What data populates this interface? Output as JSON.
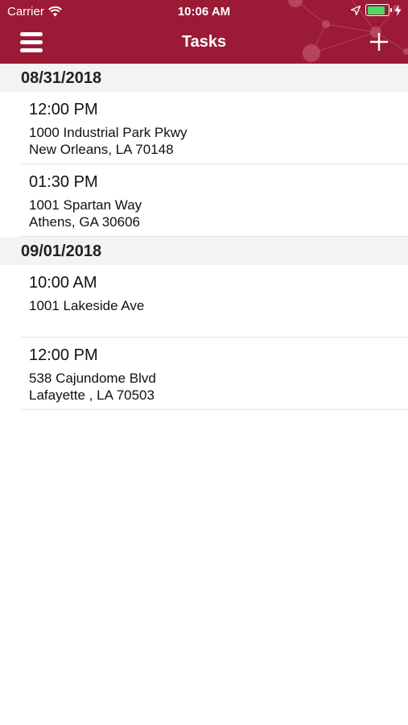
{
  "status_bar": {
    "carrier": "Carrier",
    "time": "10:06 AM",
    "battery_level": 0.85,
    "icons": [
      "wifi-icon",
      "location-arrow-icon",
      "battery-icon",
      "charging-bolt-icon"
    ]
  },
  "header": {
    "title": "Tasks",
    "menu_icon": "hamburger-menu-icon",
    "add_icon": "plus-icon"
  },
  "colors": {
    "header_bg": "#9b1b36",
    "section_bg": "#f3f3f3",
    "battery_fill": "#4cd964"
  },
  "sections": [
    {
      "date": "08/31/2018",
      "tasks": [
        {
          "time": "12:00 PM",
          "line1": "1000 Industrial Park Pkwy",
          "line2": "New Orleans, LA 70148"
        },
        {
          "time": "01:30 PM",
          "line1": "1001 Spartan Way",
          "line2": "Athens, GA 30606"
        }
      ]
    },
    {
      "date": "09/01/2018",
      "tasks": [
        {
          "time": "10:00 AM",
          "line1": "1001 Lakeside Ave",
          "line2": ""
        },
        {
          "time": "12:00 PM",
          "line1": "538 Cajundome Blvd",
          "line2": "Lafayette , LA 70503"
        }
      ]
    }
  ]
}
